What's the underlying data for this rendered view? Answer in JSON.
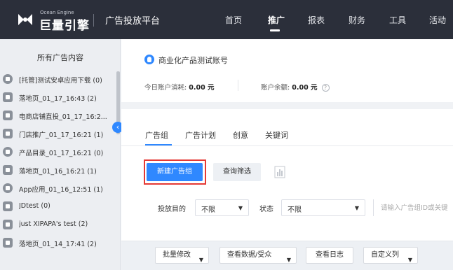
{
  "brand": {
    "english": "Ocean Engine",
    "chinese": "巨量引擎",
    "platform": "广告投放平台"
  },
  "nav": {
    "items": [
      "首页",
      "推广",
      "报表",
      "财务",
      "工具",
      "活动"
    ],
    "active": "推广"
  },
  "sidebar": {
    "title": "所有广告内容",
    "items": [
      {
        "label": "[托管]测试安卓应用下载 (0)"
      },
      {
        "label": "落地页_01_17_16:43 (2)"
      },
      {
        "label": "电商店铺直投_01_17_16:2..."
      },
      {
        "label": "门店推广_01_17_16:21 (1)"
      },
      {
        "label": "产品目录_01_17_16:21 (0)"
      },
      {
        "label": "落地页_01_16_16:21 (1)"
      },
      {
        "label": "App应用_01_16_12:51 (1)"
      },
      {
        "label": "JDtest (0)"
      },
      {
        "label": "just XIPAPA's test (2)"
      },
      {
        "label": "落地页_01_14_17:41 (2)"
      }
    ],
    "collapse_glyph": "‹"
  },
  "account": {
    "name": "商业化产品测试账号",
    "today_spend_label": "今日账户消耗:",
    "today_spend_value": "0.00 元",
    "balance_label": "账户余额:",
    "balance_value": "0.00 元",
    "help_glyph": "?"
  },
  "tabs": [
    "广告组",
    "广告计划",
    "创意",
    "关键词"
  ],
  "active_tab": "广告组",
  "actions": {
    "new_group": "新建广告组",
    "query_filter": "查询筛选"
  },
  "filters": {
    "purpose_label": "投放目的",
    "purpose_value": "不限",
    "status_label": "状态",
    "status_value": "不限",
    "search_placeholder": "请输入广告组ID或关键"
  },
  "toolbar": {
    "batch_edit": "批量修改",
    "view_data": "查看数据/受众",
    "view_log": "查看日志",
    "custom_columns": "自定义列"
  },
  "colors": {
    "topbar": "#2b2f3a",
    "primary": "#2f88ff",
    "highlight": "#e53935"
  }
}
